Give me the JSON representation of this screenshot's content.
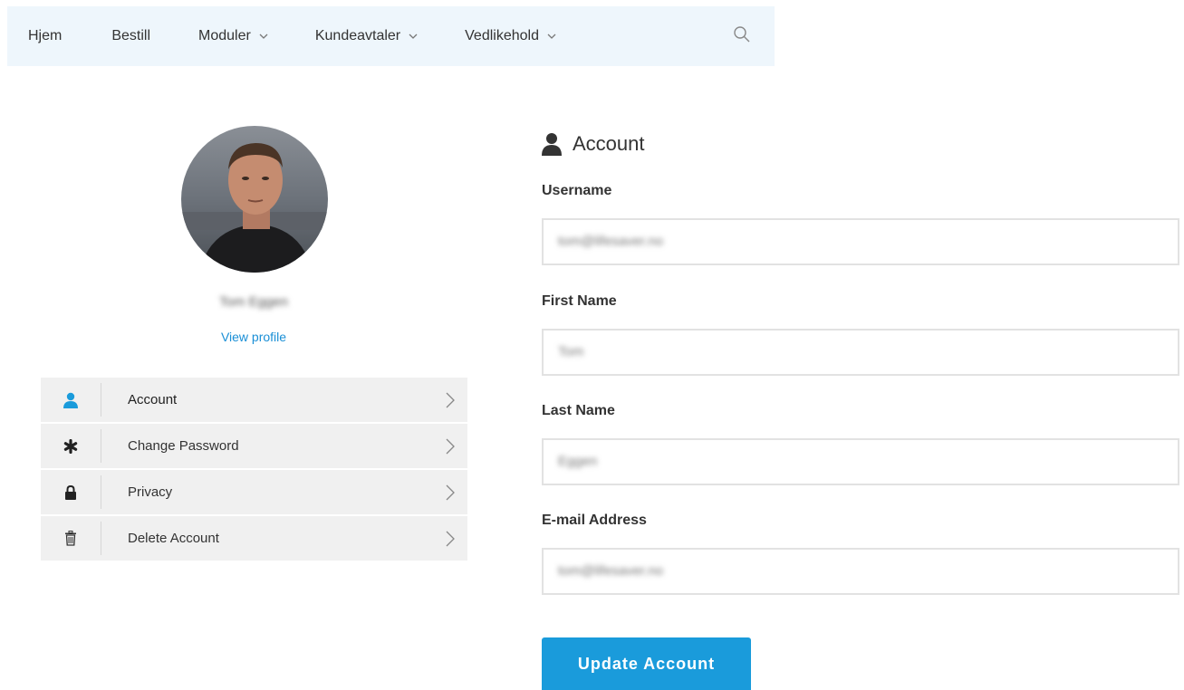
{
  "nav": {
    "items": [
      {
        "label": "Hjem",
        "has_dropdown": false
      },
      {
        "label": "Bestill",
        "has_dropdown": false
      },
      {
        "label": "Moduler",
        "has_dropdown": true
      },
      {
        "label": "Kundeavtaler",
        "has_dropdown": true
      },
      {
        "label": "Vedlikehold",
        "has_dropdown": true
      }
    ],
    "search_icon": "search-icon"
  },
  "profile": {
    "name": "Tom Eggen",
    "view_profile_label": "View profile"
  },
  "menu": {
    "items": [
      {
        "label": "Account",
        "icon": "user-icon",
        "active": true
      },
      {
        "label": "Change Password",
        "icon": "asterisk-icon",
        "active": false
      },
      {
        "label": "Privacy",
        "icon": "lock-icon",
        "active": false
      },
      {
        "label": "Delete Account",
        "icon": "trash-icon",
        "active": false
      }
    ]
  },
  "account": {
    "title": "Account",
    "fields": {
      "username": {
        "label": "Username",
        "value": "tom@lifesaver.no"
      },
      "first_name": {
        "label": "First Name",
        "value": "Tom"
      },
      "last_name": {
        "label": "Last Name",
        "value": "Eggen"
      },
      "email": {
        "label": "E-mail Address",
        "value": "tom@lifesaver.no"
      }
    },
    "update_button_label": "Update Account"
  },
  "colors": {
    "accent": "#1a9bdb",
    "link": "#1a8fd6",
    "nav_bg": "#eef6fc",
    "menu_bg": "#f0f0f0"
  }
}
